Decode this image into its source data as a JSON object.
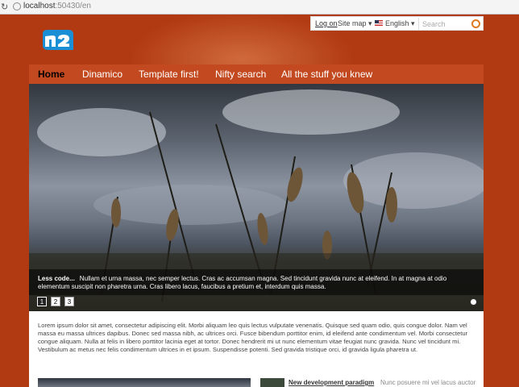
{
  "browser": {
    "url_host": "localhost",
    "url_path": ":50430/en"
  },
  "topbar": {
    "login": "Log on",
    "sitemap": "Site map",
    "language": "English",
    "search_placeholder": "Search"
  },
  "nav": {
    "items": [
      "Home",
      "Dinamico",
      "Template first!",
      "Nifty search",
      "All the stuff you knew"
    ]
  },
  "logo": {
    "text": "n2"
  },
  "slider": {
    "caption_title": "Less code...",
    "caption_text": "Nullam et urna massa, nec semper lectus. Cras ac accumsan magna. Sed tincidunt gravida nunc at eleifend. In at magna at odio elementum suscipit non pharetra urna. Cras libero lacus, faucibus a pretium et, interdum quis massa.",
    "pages": [
      "1",
      "2",
      "3"
    ]
  },
  "content": {
    "lorem": "Lorem ipsum dolor sit amet, consectetur adipiscing elit. Morbi aliquam leo quis lectus vulputate venenatis. Quisque sed quam odio, quis congue dolor. Nam vel massa eu massa ultrices dapibus. Donec sed massa nibh, ac ultrices orci. Fusce bibendum porttitor enim, id eleifend ante condimentum vel. Morbi consectetur congue aliquam. Nulla at felis in libero porttitor lacinia eget at tortor. Donec hendrerit mi ut nunc elementum vitae feugiat nunc gravida. Nunc vel tincidunt mi. Vestibulum ac metus nec felis condimentum ultrices in et ipsum. Suspendisse potenti. Sed gravida tristique orci, id gravida ligula pharetra ut.",
    "news_title": "New development paradigm",
    "news_body": "Nunc posuere mi vel lacus auctor"
  },
  "colors": {
    "brand": "#b13a12",
    "nav": "#c34a20",
    "accent": "#e07a1f"
  }
}
